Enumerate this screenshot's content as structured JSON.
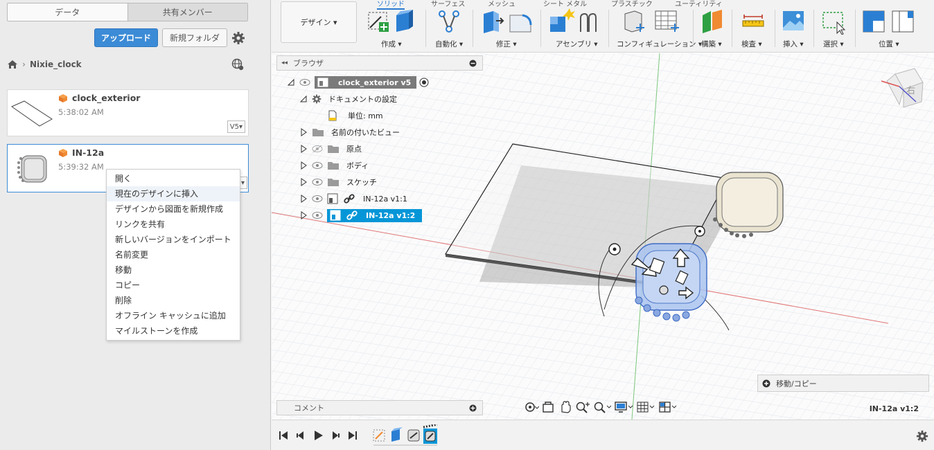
{
  "data_panel": {
    "tabs": {
      "data": "データ",
      "members": "共有メンバー"
    },
    "upload_label": "アップロード",
    "new_folder_label": "新規フォルダ",
    "breadcrumb": {
      "project": "Nixie_clock"
    },
    "files": [
      {
        "name": "clock_exterior",
        "time": "5:38:02 AM",
        "version": "V5▾"
      },
      {
        "name": "IN-12a",
        "time": "5:39:32 AM"
      }
    ],
    "context_menu": [
      "開く",
      "現在のデザインに挿入",
      "デザインから図面を新規作成",
      "リンクを共有",
      "新しいバージョンをインポート",
      "名前変更",
      "移動",
      "コピー",
      "削除",
      "オフライン キャッシュに追加",
      "マイルストーンを作成"
    ]
  },
  "toolbar": {
    "tabs": [
      "ソリッド",
      "サーフェス",
      "メッシュ",
      "シート メタル",
      "プラスチック",
      "ユーティリティ"
    ],
    "workspace": "デザイン ▾",
    "groups": {
      "create": "作成 ▾",
      "automate": "自動化 ▾",
      "modify": "修正 ▾",
      "assemble": "アセンブリ ▾",
      "config": "コンフィギュレーション ▾",
      "construct": "構築 ▾",
      "inspect": "検査 ▾",
      "insert": "挿入 ▾",
      "select": "選択 ▾",
      "position": "位置 ▾"
    }
  },
  "browser": {
    "title": "ブラウザ",
    "root": "clock_exterior v5",
    "items": {
      "doc_settings": "ドキュメントの設定",
      "units": "単位: mm",
      "named_views": "名前の付いたビュー",
      "origin": "原点",
      "bodies": "ボディ",
      "sketches": "スケッチ",
      "comp1": "IN-12a v1:1",
      "comp2": "IN-12a v1:2"
    }
  },
  "viewcube": {
    "face_label": "右"
  },
  "comments_label": "コメント",
  "move_copy_label": "移動/コピー",
  "selected_component": "IN-12a v1:2",
  "colors": {
    "accent": "#2a7ad0",
    "upload": "#3c8bd6",
    "selection": "#0696d7"
  }
}
